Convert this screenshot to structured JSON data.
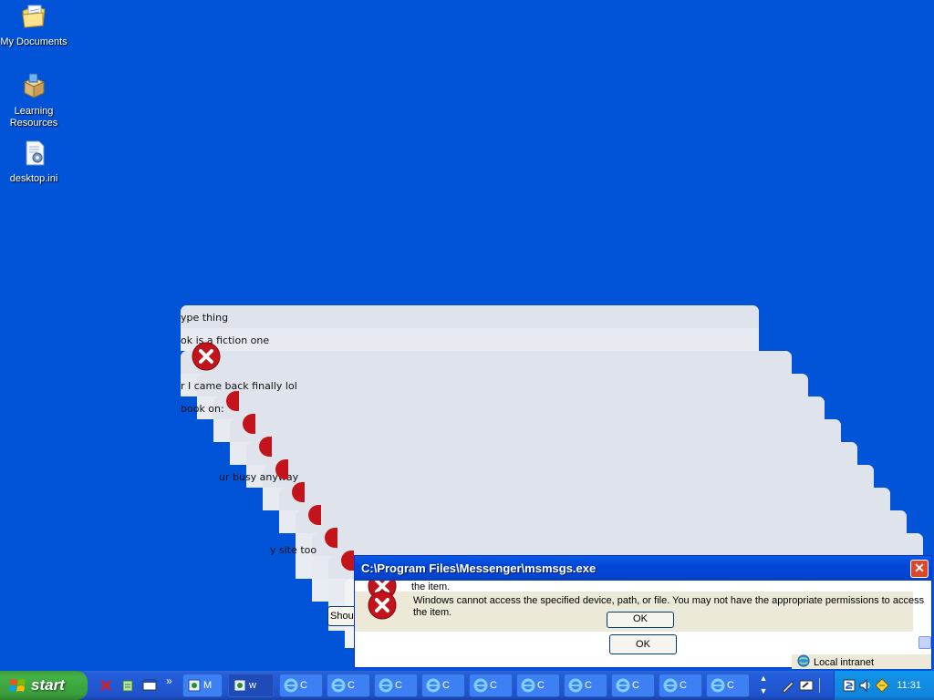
{
  "desktop": {
    "icons": [
      {
        "label": "My Documents"
      },
      {
        "label": "Learning Resources"
      },
      {
        "label": "desktop.ini"
      }
    ]
  },
  "background_chat": {
    "lines": [
      "ype thing",
      "ok is a fiction one",
      "r I came back finally lol",
      "book on:",
      "ur busy anyway",
      "y site too"
    ],
    "partial_button": "Shout M",
    "partial_ok": "OK"
  },
  "dialog": {
    "title": "C:\\Program Files\\Messenger\\msmsgs.exe",
    "message_top_partial": "the item.",
    "message": "Windows cannot access the specified device, path, or file.  You may not have the appropriate permissions to access the item.",
    "ok_label": "OK",
    "close_symbol": "✕"
  },
  "statusbar": {
    "zone": "Local intranet"
  },
  "taskbar": {
    "start_label": "start",
    "chevron": "»",
    "buttons": [
      {
        "label": "M"
      },
      {
        "label": "w"
      },
      {
        "label": "C"
      },
      {
        "label": "C"
      },
      {
        "label": "C"
      },
      {
        "label": "C"
      },
      {
        "label": "C"
      },
      {
        "label": "C"
      },
      {
        "label": "C"
      },
      {
        "label": "C"
      },
      {
        "label": "C"
      },
      {
        "label": "C"
      }
    ],
    "clock": "11:31"
  },
  "colors": {
    "desktop": "#0153d8",
    "error_red": "#c4141b",
    "title_blue": "#0146d6"
  }
}
